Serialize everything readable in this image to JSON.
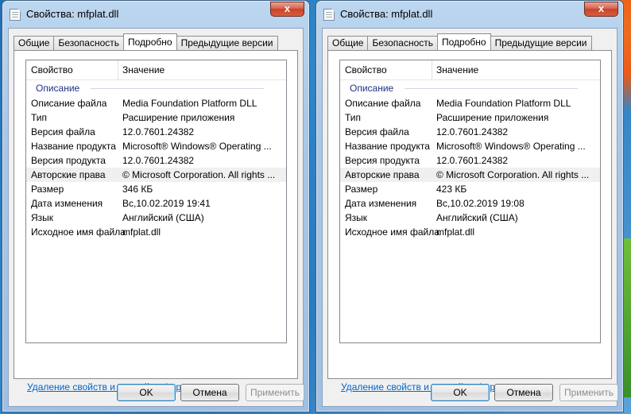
{
  "windows": [
    {
      "title": "Свойства: mfplat.dll",
      "close_glyph": "x",
      "tabs": [
        "Общие",
        "Безопасность",
        "Подробно",
        "Предыдущие версии"
      ],
      "active_tab": "Подробно",
      "columns": {
        "property": "Свойство",
        "value": "Значение"
      },
      "section": "Описание",
      "rows": [
        {
          "k": "Описание файла",
          "v": "Media Foundation Platform DLL"
        },
        {
          "k": "Тип",
          "v": "Расширение приложения"
        },
        {
          "k": "Версия файла",
          "v": "12.0.7601.24382"
        },
        {
          "k": "Название продукта",
          "v": "Microsoft® Windows® Operating ..."
        },
        {
          "k": "Версия продукта",
          "v": "12.0.7601.24382"
        },
        {
          "k": "Авторские права",
          "v": "© Microsoft Corporation. All rights ..."
        },
        {
          "k": "Размер",
          "v": "346 КБ"
        },
        {
          "k": "Дата изменения",
          "v": "Вс,10.02.2019 19:41"
        },
        {
          "k": "Язык",
          "v": "Английский (США)"
        },
        {
          "k": "Исходное имя файла",
          "v": "mfplat.dll"
        }
      ],
      "remove_link": "Удаление свойств и личной информации",
      "buttons": {
        "ok": "OK",
        "cancel": "Отмена",
        "apply": "Применить"
      }
    },
    {
      "title": "Свойства: mfplat.dll",
      "close_glyph": "x",
      "tabs": [
        "Общие",
        "Безопасность",
        "Подробно",
        "Предыдущие версии"
      ],
      "active_tab": "Подробно",
      "columns": {
        "property": "Свойство",
        "value": "Значение"
      },
      "section": "Описание",
      "rows": [
        {
          "k": "Описание файла",
          "v": "Media Foundation Platform DLL"
        },
        {
          "k": "Тип",
          "v": "Расширение приложения"
        },
        {
          "k": "Версия файла",
          "v": "12.0.7601.24382"
        },
        {
          "k": "Название продукта",
          "v": "Microsoft® Windows® Operating ..."
        },
        {
          "k": "Версия продукта",
          "v": "12.0.7601.24382"
        },
        {
          "k": "Авторские права",
          "v": "© Microsoft Corporation. All rights ..."
        },
        {
          "k": "Размер",
          "v": "423 КБ"
        },
        {
          "k": "Дата изменения",
          "v": "Вс,10.02.2019 19:08"
        },
        {
          "k": "Язык",
          "v": "Английский (США)"
        },
        {
          "k": "Исходное имя файла",
          "v": "mfplat.dll"
        }
      ],
      "remove_link": "Удаление свойств и личной информации",
      "buttons": {
        "ok": "OK",
        "cancel": "Отмена",
        "apply": "Применить"
      }
    }
  ]
}
